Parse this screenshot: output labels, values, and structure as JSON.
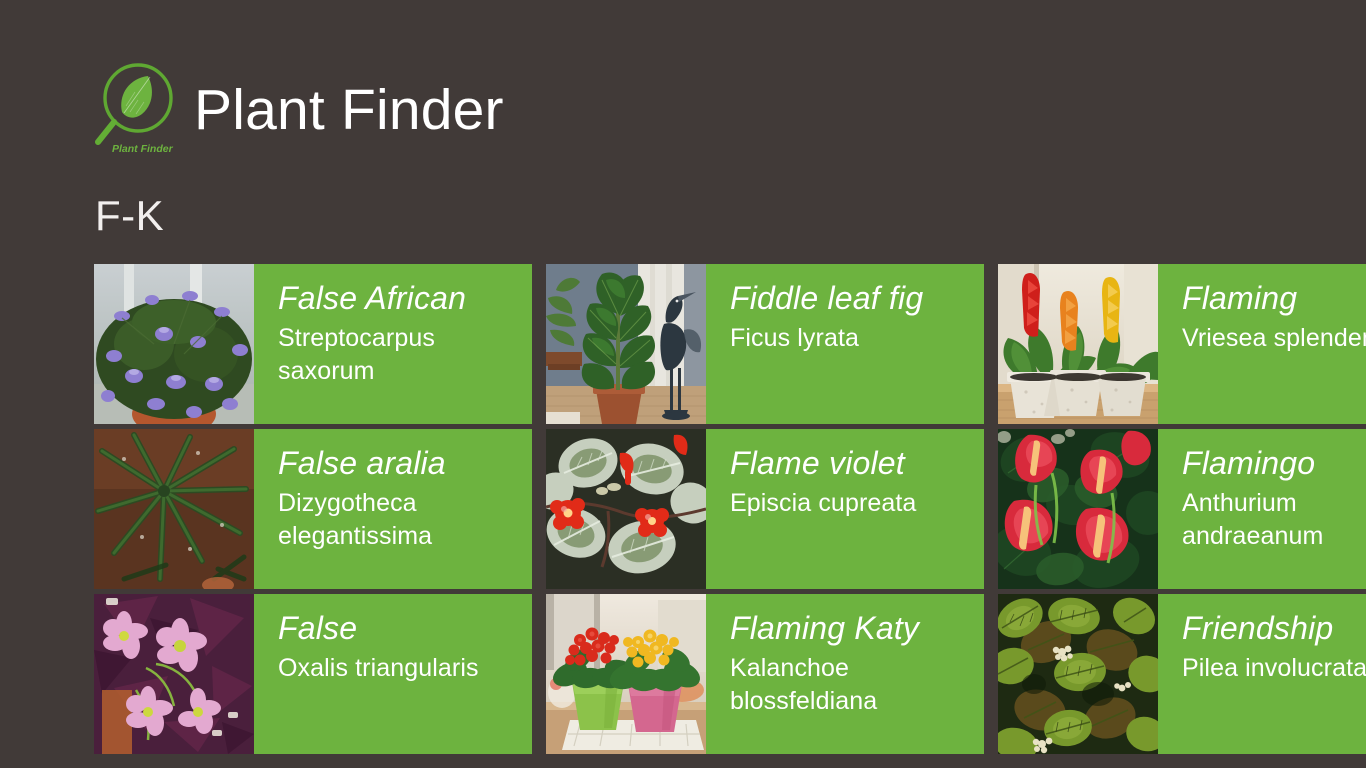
{
  "app": {
    "title": "Plant Finder",
    "logo_caption": "Plant Finder",
    "logo_icon": "magnifier-leaf-icon",
    "accent_green": "#6DB33F",
    "background": "#413A38",
    "text_color": "#FFFFFF"
  },
  "group": {
    "header": "F-K"
  },
  "tiles": [
    {
      "title": "False African",
      "subtitle_lines": [
        "Streptocarpus",
        "saxorum"
      ],
      "thumb_name": "streptocarpus-saxorum-photo"
    },
    {
      "title": "False aralia",
      "subtitle_lines": [
        "Dizygotheca",
        "elegantissima"
      ],
      "thumb_name": "dizygotheca-elegantissima-photo"
    },
    {
      "title": "False",
      "subtitle_lines": [
        "Oxalis triangularis"
      ],
      "thumb_name": "oxalis-triangularis-photo"
    },
    {
      "title": "Fiddle leaf fig",
      "subtitle_lines": [
        "Ficus lyrata"
      ],
      "thumb_name": "ficus-lyrata-photo"
    },
    {
      "title": "Flame violet",
      "subtitle_lines": [
        "Episcia cupreata"
      ],
      "thumb_name": "episcia-cupreata-photo"
    },
    {
      "title": "Flaming Katy",
      "subtitle_lines": [
        "Kalanchoe",
        "blossfeldiana"
      ],
      "thumb_name": "kalanchoe-blossfeldiana-photo"
    },
    {
      "title": "Flaming",
      "subtitle_lines": [
        "Vriesea splendens"
      ],
      "thumb_name": "vriesea-splendens-photo"
    },
    {
      "title": "Flamingo",
      "subtitle_lines": [
        "Anthurium",
        "andraeanum"
      ],
      "thumb_name": "anthurium-andraeanum-photo"
    },
    {
      "title": "Friendship",
      "subtitle_lines": [
        "Pilea involucrata"
      ],
      "thumb_name": "pilea-involucrata-photo"
    }
  ]
}
